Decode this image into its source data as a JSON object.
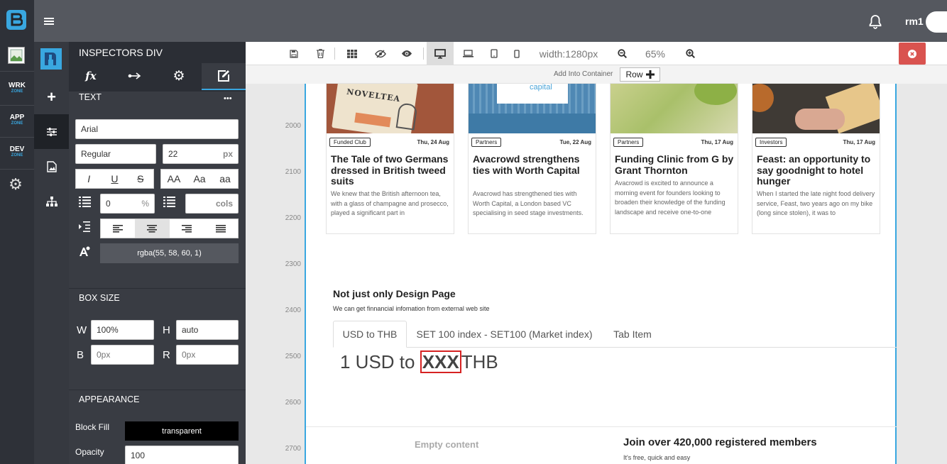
{
  "topbar": {
    "user": "rm1"
  },
  "rail": {
    "items": [
      {
        "label": "WRK",
        "zone": "ZONE"
      },
      {
        "label": "APP",
        "zone": "ZONE"
      },
      {
        "label": "DEV",
        "zone": "ZONE"
      }
    ]
  },
  "inspector": {
    "title": "INSPECTORS DIV",
    "tabs": {
      "fx": "fx"
    },
    "text_section": "TEXT",
    "more": "•••",
    "font_family": "Arial",
    "font_weight": "Regular",
    "font_size": "22",
    "font_unit": "px",
    "style_buttons": [
      "I",
      "U",
      "S"
    ],
    "case_buttons": [
      "AA",
      "Aa",
      "aa"
    ],
    "line_height": "0",
    "line_height_unit": "%",
    "cols_unit": "cols",
    "color": "rgba(55, 58, 60, 1)",
    "box_section": "BOX SIZE",
    "w_label": "W",
    "w_value": "100%",
    "h_label": "H",
    "h_value": "auto",
    "b_label": "B",
    "b_placeholder": "0px",
    "r_label": "R",
    "r_placeholder": "0px",
    "appearance_section": "APPEARANCE",
    "block_fill_label": "Block Fill",
    "block_fill_value": "transparent",
    "opacity_label": "Opacity",
    "opacity_value": "100"
  },
  "toolbar": {
    "width": "width:1280px",
    "zoom": "65%",
    "add_into": "Add Into Container",
    "row_label": "Row"
  },
  "ruler": [
    "2000",
    "2100",
    "2200",
    "2300",
    "2400",
    "2500",
    "2600",
    "2700"
  ],
  "cards": [
    {
      "tag": "Funded Club",
      "date": "Thu, 24 Aug",
      "title": "The Tale of two Germans dressed in British tweed suits",
      "text": "We knew that the British afternoon tea, with a glass of champagne and prosecco, played a significant part in",
      "img_text": "NOVELTEA"
    },
    {
      "tag": "Partners",
      "date": "Tue, 22 Aug",
      "title": "Avacrowd strengthens ties with Worth Capital",
      "text": "Avacrowd has strengthened ties with Worth Capital, a London based VC specialising in seed stage investments.",
      "img_text": "capital"
    },
    {
      "tag": "Partners",
      "date": "Thu, 17 Aug",
      "title": "Funding Clinic from G by Grant Thornton",
      "text": "Avacrowd is excited to announce a morning event for founders looking to broaden their knowledge of the funding landscape and receive one-to-one"
    },
    {
      "tag": "Investors",
      "date": "Thu, 17 Aug",
      "title": "Feast: an opportunity to say goodnight to hotel hunger",
      "text": "When I started the late night food delivery service, Feast, two years ago on my bike (long since stolen), it was to"
    }
  ],
  "section": {
    "title": "Not just only Design Page",
    "subtitle": "We can get finnancial infomation from external web site"
  },
  "tabs": [
    "USD to THB",
    "SET 100 index - SET100 (Market index)",
    "Tab Item"
  ],
  "rate": {
    "prefix": "1 USD to ",
    "value": "XXX",
    "suffix": "THB"
  },
  "footer": {
    "empty": "Empty content",
    "join": "Join over 420,000 registered members",
    "free": "It's free, quick and easy"
  }
}
